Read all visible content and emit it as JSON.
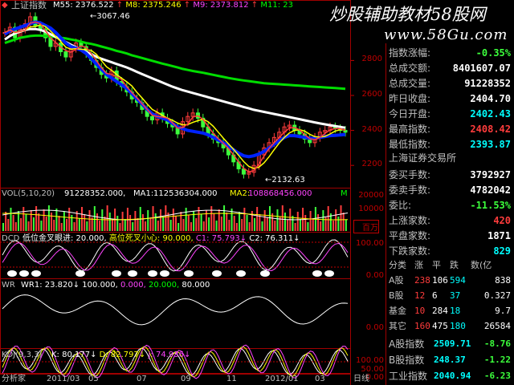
{
  "colors": {
    "up": "#ff3c3c",
    "down": "#3cff3c",
    "ma1": "#ffffff",
    "ma2": "#ffff00",
    "ma3": "#ff44ff",
    "ma4": "#00ff00",
    "bg": "#000000"
  },
  "main": {
    "title": "上证指数",
    "ma_items": [
      {
        "label": "M55:",
        "value": "2376.522",
        "color": "#ffffff",
        "arrow": "↑"
      },
      {
        "label": "M8:",
        "value": "2375.246",
        "color": "#ffff00",
        "arrow": "↑"
      },
      {
        "label": "M9:",
        "value": "2373.812",
        "color": "#ff44ff",
        "arrow": "↑"
      },
      {
        "label": "M11:",
        "value": "23",
        "color": "#00ff00",
        "arrow": ""
      }
    ],
    "high_marker": "3067.46",
    "low_marker": "2132.63",
    "y_ticks": [
      "2800",
      "2600",
      "2400",
      "2200"
    ],
    "price_series": [
      2960,
      2990,
      2930,
      2980,
      3010,
      3050,
      3000,
      2980,
      2930,
      2880,
      2900,
      2850,
      2820,
      2870,
      2900,
      2880,
      2840,
      2800,
      2760,
      2720,
      2700,
      2740,
      2680,
      2650,
      2620,
      2580,
      2560,
      2520,
      2480,
      2460,
      2500,
      2470,
      2440,
      2420,
      2380,
      2450,
      2480,
      2500,
      2470,
      2420,
      2380,
      2350,
      2330,
      2300,
      2260,
      2220,
      2180,
      2150,
      2160,
      2200,
      2260,
      2300,
      2330,
      2360,
      2390,
      2420,
      2430,
      2400,
      2380,
      2350,
      2330,
      2360,
      2390,
      2400,
      2420,
      2410,
      2400,
      2390
    ],
    "ma_white": [
      2920,
      2940,
      2955,
      2965,
      2975,
      2980,
      2980,
      2975,
      2965,
      2950,
      2935,
      2920,
      2905,
      2890,
      2875,
      2860,
      2848,
      2835,
      2822,
      2810,
      2800,
      2790,
      2780,
      2770,
      2760,
      2748,
      2735,
      2722,
      2710,
      2698,
      2686,
      2674,
      2662,
      2650,
      2640,
      2630,
      2622,
      2614,
      2606,
      2598,
      2590,
      2582,
      2574,
      2566,
      2558,
      2550,
      2542,
      2534,
      2526,
      2518,
      2512,
      2506,
      2500,
      2494,
      2488,
      2482,
      2476,
      2470,
      2464,
      2458,
      2452,
      2446,
      2440,
      2435,
      2430,
      2425,
      2420,
      2415
    ],
    "ma_green": [
      2900,
      2910,
      2920,
      2930,
      2935,
      2940,
      2942,
      2942,
      2940,
      2938,
      2935,
      2930,
      2926,
      2920,
      2915,
      2908,
      2900,
      2895,
      2888,
      2880,
      2872,
      2864,
      2855,
      2848,
      2840,
      2830,
      2822,
      2814,
      2806,
      2798,
      2790,
      2782,
      2775,
      2768,
      2760,
      2752,
      2746,
      2740,
      2735,
      2730,
      2724,
      2718,
      2712,
      2706,
      2700,
      2695,
      2690,
      2686,
      2682,
      2678,
      2674,
      2670,
      2668,
      2666,
      2664,
      2662,
      2660,
      2658,
      2656,
      2654,
      2652,
      2650,
      2648,
      2646,
      2644,
      2642,
      2640,
      2638
    ],
    "ma_blue": [
      2950,
      2970,
      2980,
      2990,
      3000,
      3010,
      3020,
      3015,
      3000,
      2985,
      2960,
      2930,
      2900,
      2880,
      2870,
      2860,
      2840,
      2810,
      2780,
      2750,
      2720,
      2700,
      2680,
      2660,
      2640,
      2610,
      2580,
      2550,
      2520,
      2495,
      2480,
      2470,
      2460,
      2440,
      2420,
      2410,
      2400,
      2395,
      2390,
      2385,
      2375,
      2360,
      2345,
      2330,
      2310,
      2290,
      2270,
      2255,
      2250,
      2255,
      2265,
      2280,
      2300,
      2320,
      2340,
      2360,
      2370,
      2370,
      2365,
      2360,
      2355,
      2355,
      2360,
      2365,
      2370,
      2372,
      2374,
      2376
    ]
  },
  "vol": {
    "title": "VOL(5,10,20)",
    "v1": "91228352.000,",
    "ma1_label": "MA1:",
    "ma1_value": "112536304.000",
    "ma2_label": "MA2:",
    "ma2_value": "108868456.000",
    "tail": "M",
    "y_ticks": [
      "20000",
      "10000",
      "百万"
    ]
  },
  "dcd": {
    "title": "DCD",
    "items": [
      {
        "text": "低位金叉眼进: 20.000,",
        "color": "#ffffff"
      },
      {
        "text": "高位死叉小心: 90.000,",
        "color": "#ffff00"
      },
      {
        "text": "C1: 75.793↓",
        "color": "#ff44ff"
      },
      {
        "text": "C2: 76.311↓",
        "color": "#ffffff"
      }
    ],
    "y_ticks": [
      "100.00",
      "0.00"
    ]
  },
  "wr": {
    "title": "WR",
    "items": [
      {
        "text": "WR1: 23.820↓",
        "color": "#ffffff"
      },
      {
        "text": "100.000,",
        "color": "#ffffff"
      },
      {
        "text": "0.000,",
        "color": "#ff44ff"
      },
      {
        "text": "20.000,",
        "color": "#00ff00"
      },
      {
        "text": "80.000",
        "color": "#ffffff"
      }
    ],
    "y_ticks": [
      "0.00"
    ]
  },
  "kdj": {
    "title": "KDJ(9,3,3)",
    "items": [
      {
        "text": "K: 80.177↓",
        "color": "#ffffff"
      },
      {
        "text": "D: 82.797↓",
        "color": "#ffff00"
      },
      {
        "text": "J: 74.936↓",
        "color": "#ff44ff"
      }
    ],
    "y_ticks": [
      "100.00",
      "50.00",
      "0.00"
    ]
  },
  "bottom": {
    "left": "分析家",
    "dates": [
      "2011/03",
      "05",
      "07",
      "09",
      "11",
      "2012/01",
      "03"
    ],
    "right": "日线"
  },
  "watermark": {
    "line1": "炒股辅助教材58股网",
    "line2": "www.58Gu.com"
  },
  "stats": {
    "rows": [
      {
        "k": "指数涨幅:",
        "v": "-0.35%",
        "color": "#3cff3c"
      },
      {
        "k": "总成交额:",
        "v": "8401607.07",
        "color": "#ffffff"
      },
      {
        "k": "总成交量:",
        "v": "91228352",
        "color": "#ffffff"
      },
      {
        "k": "昨日收盘:",
        "v": "2404.70",
        "color": "#ffffff"
      },
      {
        "k": "今日开盘:",
        "v": "2402.43",
        "color": "#00ffff"
      },
      {
        "k": "最高指数:",
        "v": "2408.42",
        "color": "#ff3c3c"
      },
      {
        "k": "最低指数:",
        "v": "2393.87",
        "color": "#00ffff"
      }
    ],
    "exchange": "上海证券交易所",
    "rows2": [
      {
        "k": "委买手数:",
        "v": "3792927",
        "color": "#ffffff"
      },
      {
        "k": "委卖手数:",
        "v": "4782042",
        "color": "#ffffff"
      },
      {
        "k": "委比:",
        "v": "-11.53%",
        "color": "#3cff3c"
      },
      {
        "k": "上涨家数:",
        "v": "420",
        "color": "#ff3c3c"
      },
      {
        "k": "平盘家数:",
        "v": "1871",
        "color": "#ffffff"
      },
      {
        "k": "下跌家数:",
        "v": "829",
        "color": "#00ffff"
      }
    ],
    "table_head": [
      "分类",
      "涨",
      "平",
      "跌",
      "数(亿"
    ],
    "table_rows": [
      {
        "name": "A股",
        "up": "238",
        "flat": "106",
        "down": "594",
        "amt": "838"
      },
      {
        "name": "B股",
        "up": "12",
        "flat": "6",
        "down": "37",
        "amt": "0.327"
      },
      {
        "name": "基金",
        "up": "10",
        "flat": "284",
        "down": "18",
        "amt": "9.7"
      },
      {
        "name": "其它",
        "up": "160",
        "flat": "475",
        "down": "180",
        "amt": "26584"
      }
    ],
    "indices": [
      {
        "name": "A股指数",
        "value": "2509.71",
        "change": "-8.76"
      },
      {
        "name": "B股指数",
        "value": "248.37",
        "change": "-1.22"
      },
      {
        "name": "工业指数",
        "value": "2040.94",
        "change": "-6.23"
      }
    ]
  }
}
